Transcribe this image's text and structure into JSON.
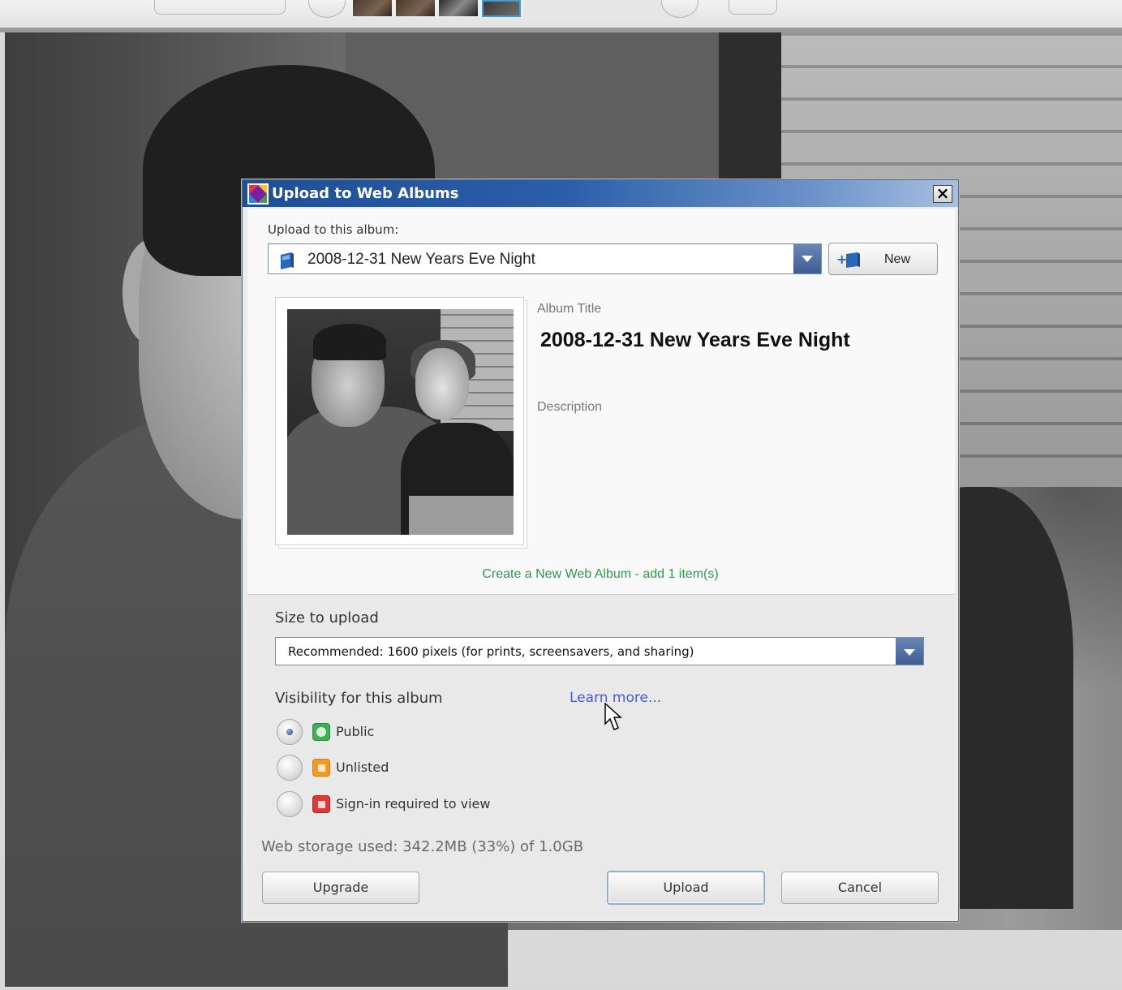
{
  "dialog": {
    "title": "Upload to Web Albums",
    "close_label": "×",
    "album_label": "Upload to this album:",
    "album_selected": "2008-12-31 New Years Eve Night",
    "new_button": "New",
    "album_title_label": "Album Title",
    "album_title": "2008-12-31 New Years Eve Night",
    "description_label": "Description",
    "create_link": "Create a New Web Album - add 1 item(s)",
    "size_label": "Size to upload",
    "size_selected": "Recommended: 1600 pixels (for prints, screensavers, and sharing)",
    "visibility_label": "Visibility for this album",
    "learn_more": "Learn more...",
    "visibility_options": [
      {
        "label": "Public",
        "icon": "globe-icon",
        "checked": true
      },
      {
        "label": "Unlisted",
        "icon": "padlock-icon",
        "checked": false
      },
      {
        "label": "Sign-in required to view",
        "icon": "locked-padlock-icon",
        "checked": false
      }
    ],
    "storage_text": "Web storage used: 342.2MB (33%) of 1.0GB",
    "buttons": {
      "upgrade": "Upgrade",
      "upload": "Upload",
      "cancel": "Cancel"
    }
  },
  "colors": {
    "titlebar": "#2b5ea9",
    "link_green": "#2f9a4c",
    "link_blue": "#4a5bd6"
  }
}
